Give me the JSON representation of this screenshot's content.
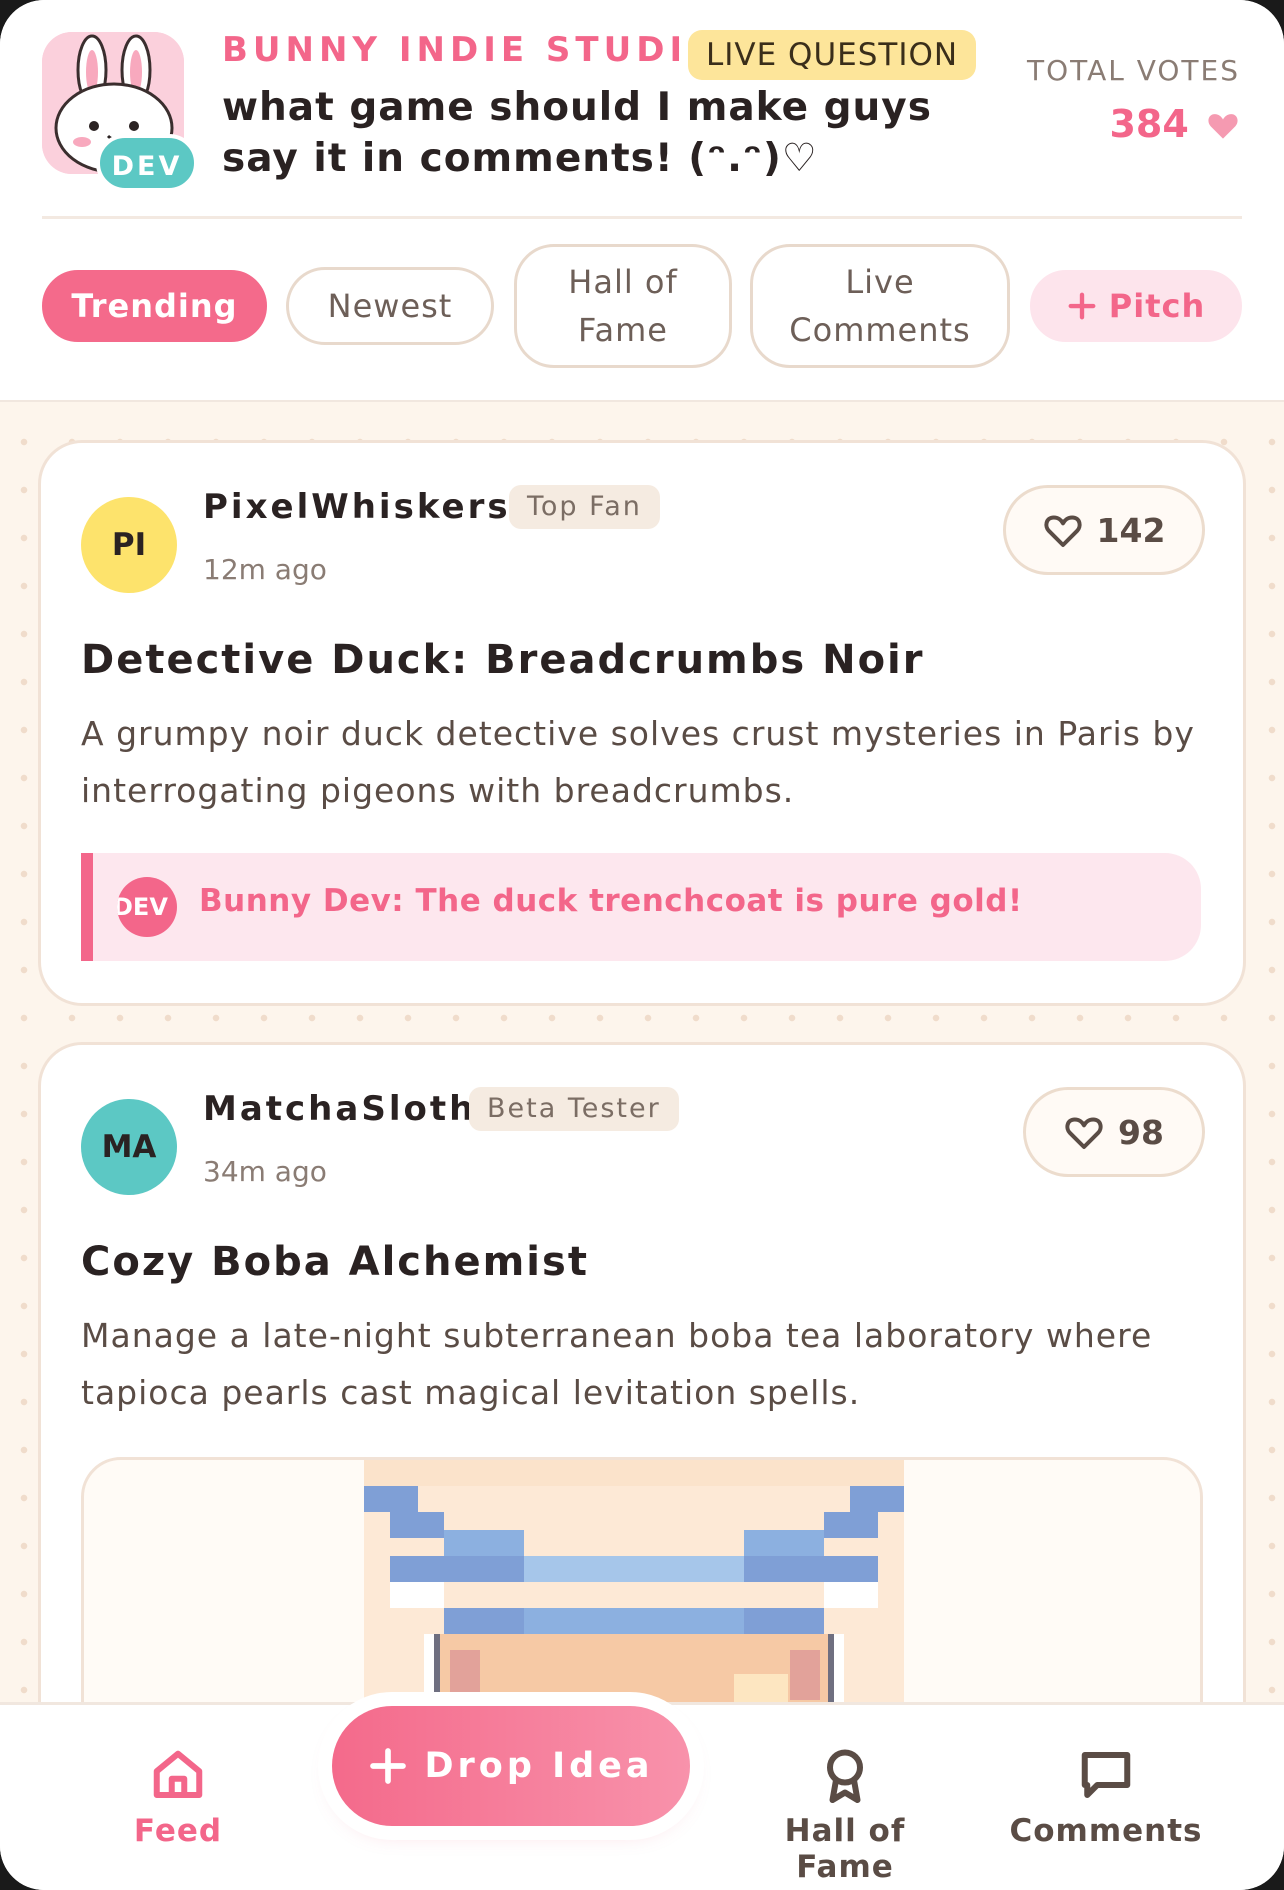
{
  "header": {
    "studio_name": "BUNNY INDIE STUDIO",
    "live_label": "LIVE QUESTION",
    "question": "what game should I make guys say it in comments! (ᵔ.ᵔ)♡",
    "dev_badge": "DEV",
    "total_votes_label": "TOTAL VOTES",
    "total_votes_value": "384"
  },
  "tabs": [
    {
      "label": "Trending",
      "active": true
    },
    {
      "label": "Newest",
      "active": false
    },
    {
      "label": "Hall of Fame",
      "active": false
    },
    {
      "label": "Live Comments",
      "active": false
    },
    {
      "label": "Pitch",
      "active": false
    }
  ],
  "posts": [
    {
      "avatar_initials": "PI",
      "avatar_color": "#fde36c",
      "username": "PixelWhiskers",
      "role": "Top Fan",
      "time": "12m ago",
      "likes": "142",
      "title": "Detective Duck: Breadcrumbs Noir",
      "description": "A grumpy noir duck detective solves crust mysteries in Paris by interrogating pigeons with breadcrumbs.",
      "dev_note_badge": "DEV",
      "dev_note": "Bunny Dev: The duck trenchcoat is pure gold!"
    },
    {
      "avatar_initials": "MA",
      "avatar_color": "#5cc8c4",
      "username": "MatchaSloth",
      "role": "Beta Tester",
      "time": "34m ago",
      "likes": "98",
      "title": "Cozy Boba Alchemist",
      "description": "Manage a late-night subterranean boba tea laboratory where tapioca pearls cast magical levitation spells."
    }
  ],
  "bottom_nav": {
    "feed": "Feed",
    "drop_idea": "Drop Idea",
    "hall_of_fame": "Hall of Fame",
    "comments": "Comments"
  },
  "colors": {
    "accent": "#f3668a",
    "teal": "#5cc8c4",
    "live_yellow": "#fde59a",
    "feed_bg": "#fdf5ec"
  }
}
